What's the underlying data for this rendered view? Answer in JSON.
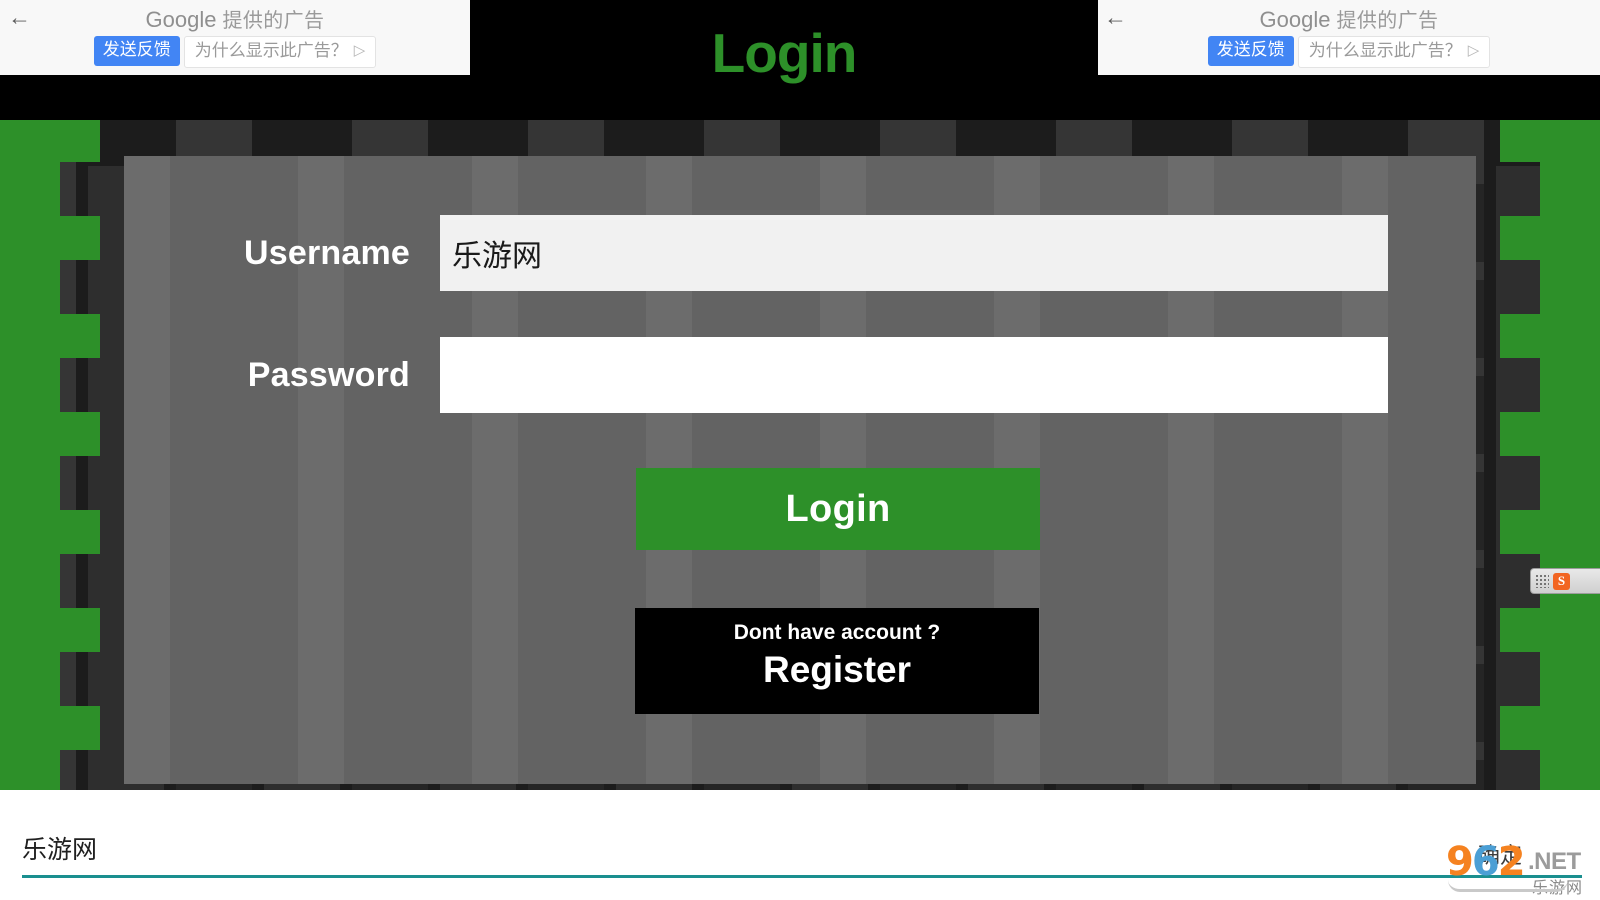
{
  "page": {
    "title": "Login",
    "title_color": "#2d9029",
    "card_bg": "#636363",
    "accent_green": "#2d9029"
  },
  "form": {
    "username": {
      "label": "Username",
      "value": "乐游网",
      "placeholder": ""
    },
    "password": {
      "label": "Password",
      "value": "",
      "placeholder": ""
    },
    "login_button": "Login",
    "register": {
      "prompt": "Dont have account ?",
      "link": "Register"
    }
  },
  "ads": {
    "left": {
      "back_icon": "back-arrow-icon",
      "brand": "Google",
      "title_suffix": "提供的广告",
      "feedback_button": "发送反馈",
      "why_button": "为什么显示此广告？",
      "why_icon": "play-triangle-icon",
      "feedback_color": "#4285f4"
    },
    "right": {
      "back_icon": "back-arrow-icon",
      "brand": "Google",
      "title_suffix": "提供的广告",
      "feedback_button": "发送反馈",
      "why_button": "为什么显示此广告？",
      "why_icon": "play-triangle-icon",
      "feedback_color": "#4285f4"
    }
  },
  "ime": {
    "icon": "sogou-input-icon",
    "letter": "S",
    "handle_icon": "drag-dots-icon"
  },
  "bottom": {
    "text": "乐游网",
    "confirm": "确定",
    "rule_color": "#1a8f8f"
  },
  "watermark": {
    "digit_9": "9",
    "digit_6": "6",
    "digit_2": "2",
    "net": ".NET",
    "cn": "乐游网",
    "color_orange": "#f58220",
    "color_blue": "#4b9fd5"
  }
}
